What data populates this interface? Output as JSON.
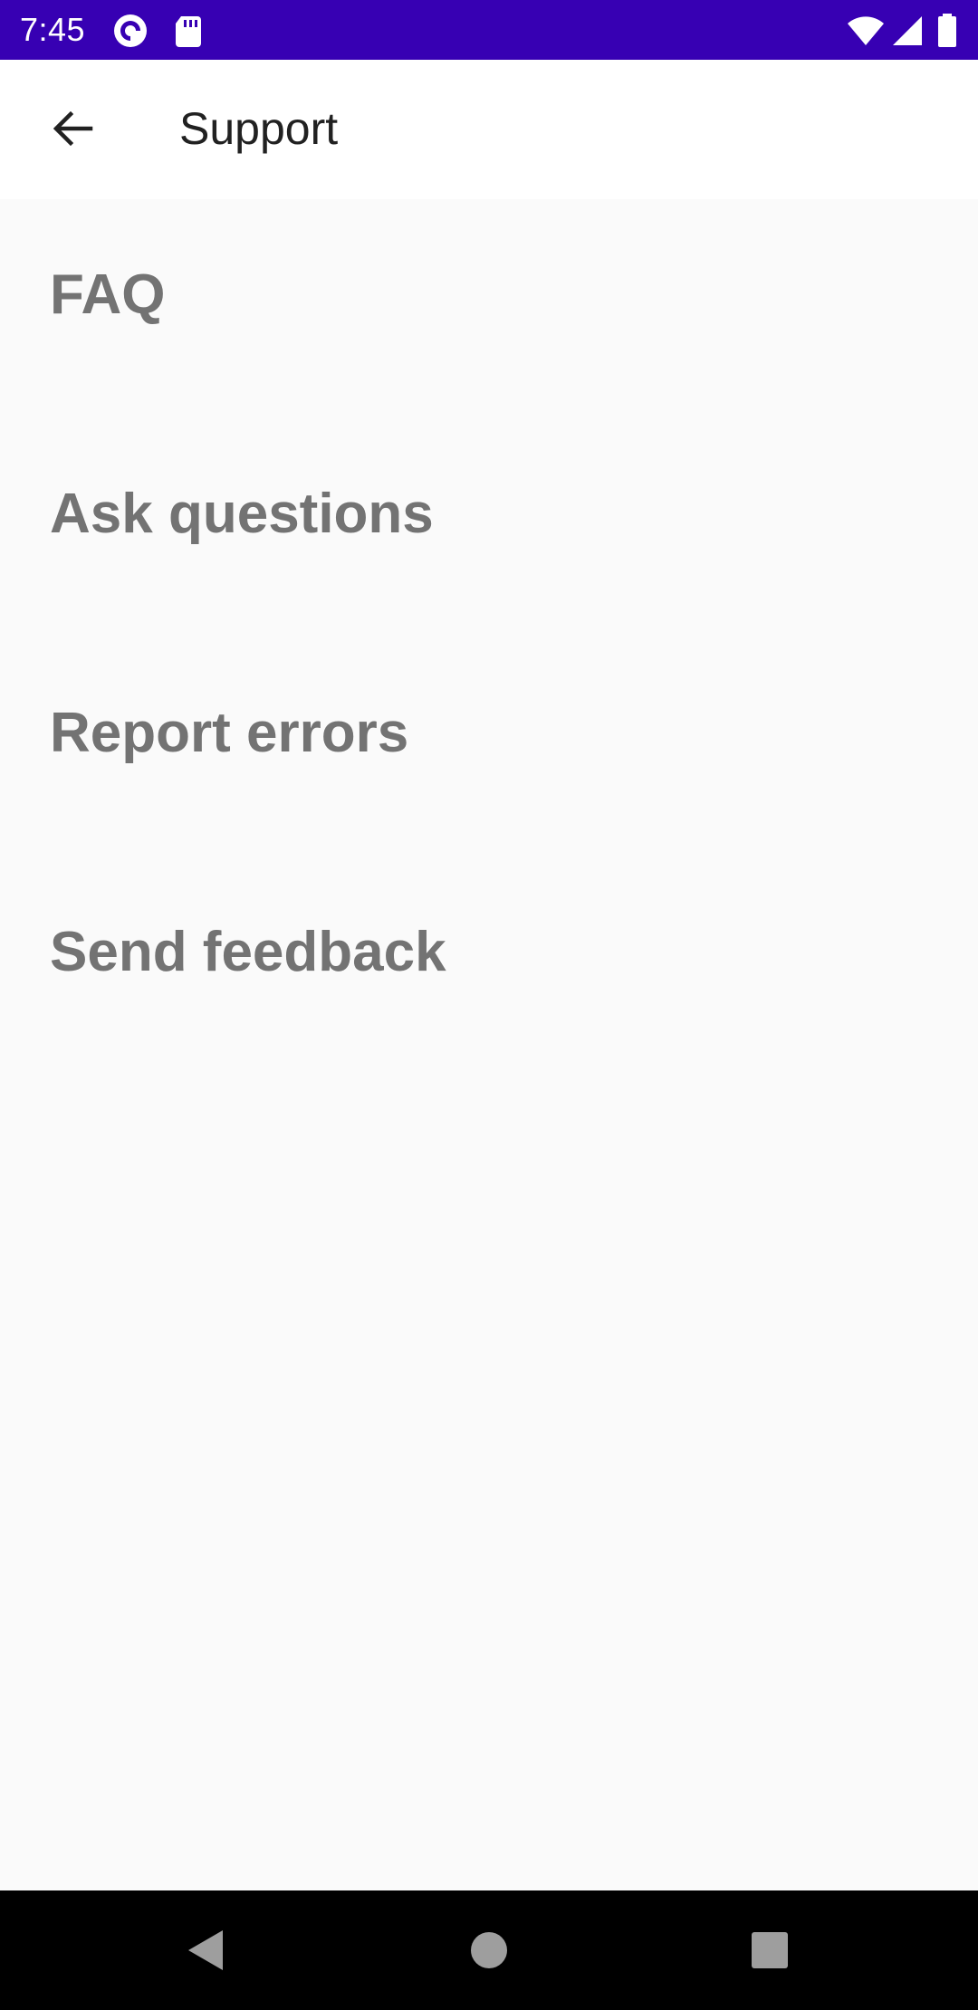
{
  "status_bar": {
    "time": "7:45",
    "background": "#3700b3",
    "icons_left": [
      "pocket-casts-icon",
      "sd-card-icon"
    ],
    "icons_right": [
      "wifi-icon",
      "cellular-signal-icon",
      "battery-icon"
    ]
  },
  "app_bar": {
    "back_icon": "arrow-back-icon",
    "title": "Support"
  },
  "menu": {
    "items": [
      {
        "label": "FAQ"
      },
      {
        "label": "Ask questions"
      },
      {
        "label": "Report errors"
      },
      {
        "label": "Send feedback"
      }
    ],
    "text_color": "#737373"
  },
  "nav_bar": {
    "buttons": [
      "back-triangle-icon",
      "home-circle-icon",
      "recents-square-icon"
    ]
  }
}
